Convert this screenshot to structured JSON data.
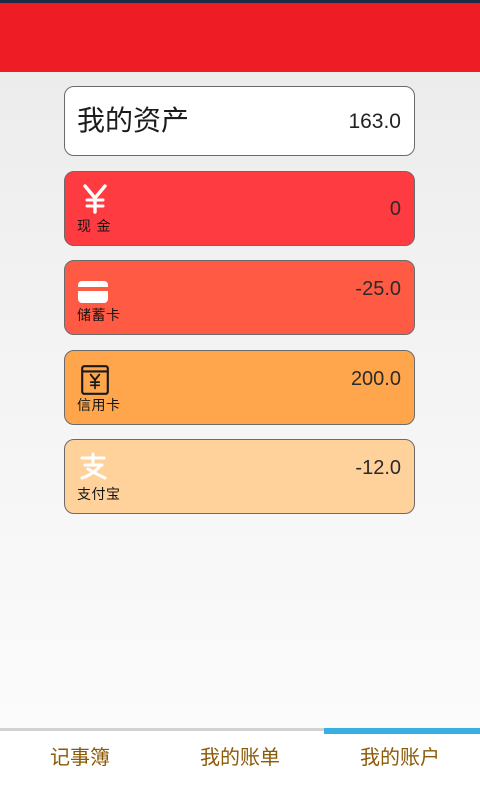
{
  "colors": {
    "header": "#ee1c25",
    "cash": "#ff3b42",
    "debit": "#ff5a43",
    "credit": "#ffa64c",
    "alipay": "#ffd29c",
    "tab_text": "#8b5a07",
    "active_indicator": "#39aee0"
  },
  "summary": {
    "title": "我的资产",
    "value": "163.0"
  },
  "accounts": [
    {
      "label": "现 金",
      "value": "0",
      "icon": "yen-icon"
    },
    {
      "label": "储蓄卡",
      "value": "-25.0",
      "icon": "debit-card-icon"
    },
    {
      "label": "信用卡",
      "value": "200.0",
      "icon": "credit-card-icon"
    },
    {
      "label": "支付宝",
      "value": "-12.0",
      "icon": "alipay-icon"
    }
  ],
  "bottom_nav": {
    "tabs": [
      {
        "label": "记事簿"
      },
      {
        "label": "我的账单"
      },
      {
        "label": "我的账户",
        "active": true
      }
    ]
  }
}
